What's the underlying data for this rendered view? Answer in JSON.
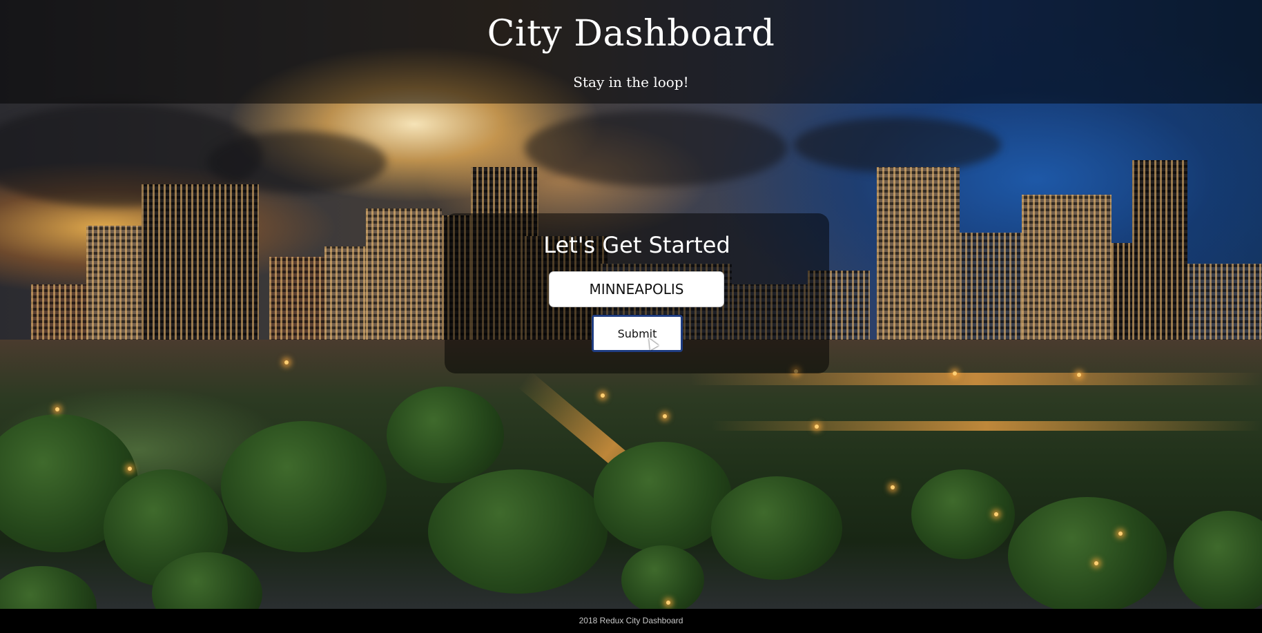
{
  "header": {
    "title": "City Dashboard",
    "subtitle": "Stay in the loop!"
  },
  "form": {
    "heading": "Let's Get Started",
    "city_input_value": "MINNEAPOLIS",
    "submit_label": "Submit"
  },
  "footer": {
    "text": "2018 Redux City Dashboard"
  },
  "background": {
    "subject": "city-skyline-at-dusk"
  },
  "colors": {
    "submit_border": "#1f3d82",
    "overlay": "rgba(0,0,0,0.5)"
  }
}
